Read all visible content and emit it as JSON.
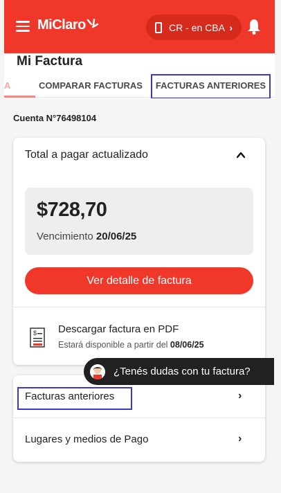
{
  "header": {
    "logo": "MiClaro",
    "location": "CR - en CBA",
    "colors": {
      "brand": "#ef3829",
      "highlight": "#3a39c9"
    }
  },
  "page": {
    "title": "Mi Factura",
    "tabs": [
      {
        "label": "A",
        "active": true
      },
      {
        "label": "COMPARAR FACTURAS"
      },
      {
        "label": "FACTURAS ANTERIORES"
      }
    ],
    "account": "Cuenta N°76498104"
  },
  "summary": {
    "heading": "Total a pagar actualizado",
    "amount": "$728,70",
    "due_label": "Vencimiento",
    "due_date": "20/06/25",
    "detail_button": "Ver detalle de factura",
    "pdf_title": "Descargar factura en PDF",
    "pdf_note": "Estará disponible a partir del",
    "pdf_date": "08/06/25"
  },
  "links": [
    {
      "label": "Facturas anteriores"
    },
    {
      "label": "Lugares y medios de Pago"
    }
  ],
  "help": {
    "label": "¿Tenés dudas con tu factura?"
  }
}
